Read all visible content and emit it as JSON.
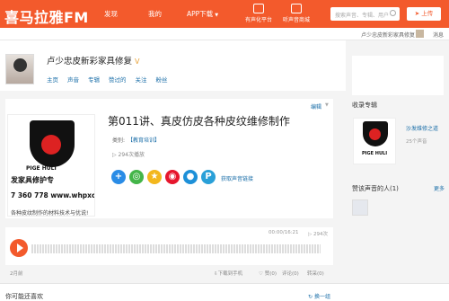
{
  "header": {
    "logo": "喜马拉雅FM",
    "nav": [
      "发现",
      "我的",
      "APP下载"
    ],
    "tools": [
      "有声化平台",
      "听声音商城"
    ],
    "search_placeholder": "搜索声音、专辑、用户",
    "upload_label": "上传"
  },
  "subbar": {
    "username": "卢少忠皮新彩家具修复",
    "messages": "消息"
  },
  "profile": {
    "name": "卢少忠皮新彩家具修复",
    "verified_mark": "V",
    "tabs": [
      "主页",
      "声音",
      "专辑",
      "赞过的",
      "关注",
      "粉丝"
    ]
  },
  "track": {
    "title": "第011讲、真皮仿皮各种皮纹维修制作",
    "category_label": "类别:",
    "category": "【教育培训】",
    "plays": "294次播放",
    "share_link": "获取声音链接",
    "edit": "编辑",
    "description": "各种皮纹制作的材料技术与优说!",
    "time": "00:00/16:21",
    "play_count": "294次"
  },
  "cover": {
    "big_text": "发家具修护专",
    "small_text": "PIGE HULI",
    "phone": "7 360 778  www.whpxc.",
    "shield_chars": [
      "皮",
      "新",
      "彩"
    ]
  },
  "actions": {
    "date": "2月前",
    "download": "下载到手机",
    "like": "赞(0)",
    "comment": "评论(0)",
    "forward": "转采(0)"
  },
  "bottom": {
    "maybe_like": "你可能还喜欢",
    "refresh": "换一组"
  },
  "sidebar": {
    "album_section": "收录专辑",
    "album_name": "沙发维修之道",
    "album_count": "25个声音",
    "album_logo_text": "PIGE HULI",
    "liked_section": "赞该声音的人(1)",
    "more": "更多"
  },
  "colors": {
    "brand": "#f35a2c",
    "link": "#1a6ea8"
  }
}
